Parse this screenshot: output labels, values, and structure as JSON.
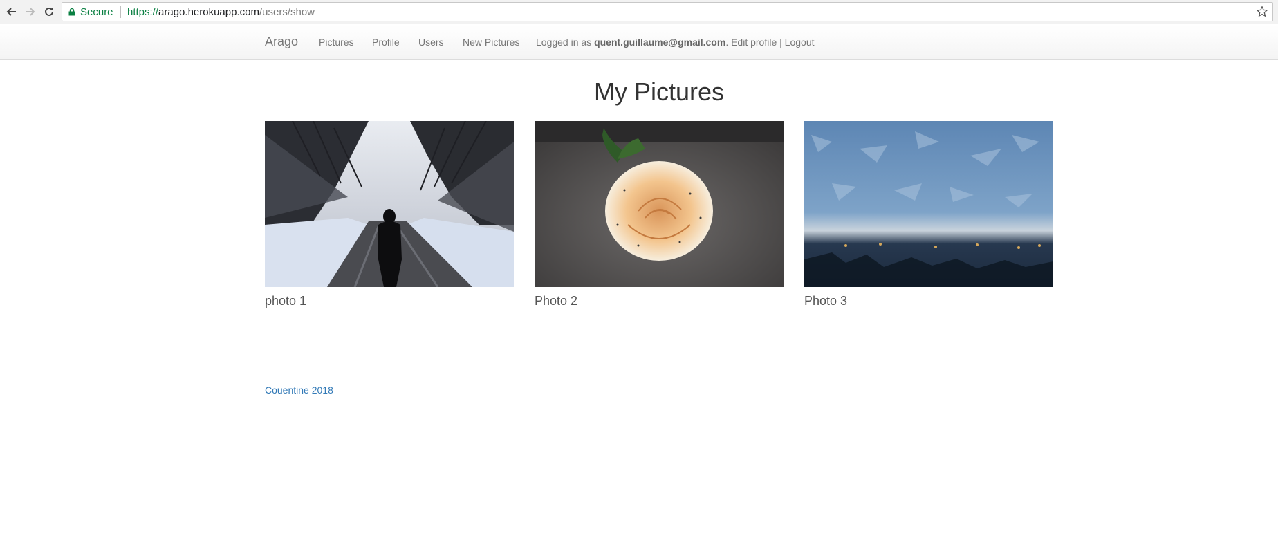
{
  "browser": {
    "secure_label": "Secure",
    "url_scheme": "https://",
    "url_host": "arago.herokuapp.com",
    "url_path": "/users/show"
  },
  "navbar": {
    "brand": "Arago",
    "links": [
      "Pictures",
      "Profile",
      "Users",
      "New Pictures"
    ],
    "logged_prefix": "Logged in as ",
    "user_email": "quent.guillaume@gmail.com",
    "logged_suffix": ".",
    "edit_profile": "Edit profile",
    "divider": "|",
    "logout": "Logout"
  },
  "main": {
    "title": "My Pictures",
    "pictures": [
      {
        "caption": "photo 1"
      },
      {
        "caption": "Photo 2"
      },
      {
        "caption": "Photo 3"
      }
    ]
  },
  "footer": {
    "credit": "Couentine 2018"
  },
  "colors": {
    "secure_green": "#0b8043",
    "link_blue": "#337ab7",
    "nav_text": "#777777"
  }
}
